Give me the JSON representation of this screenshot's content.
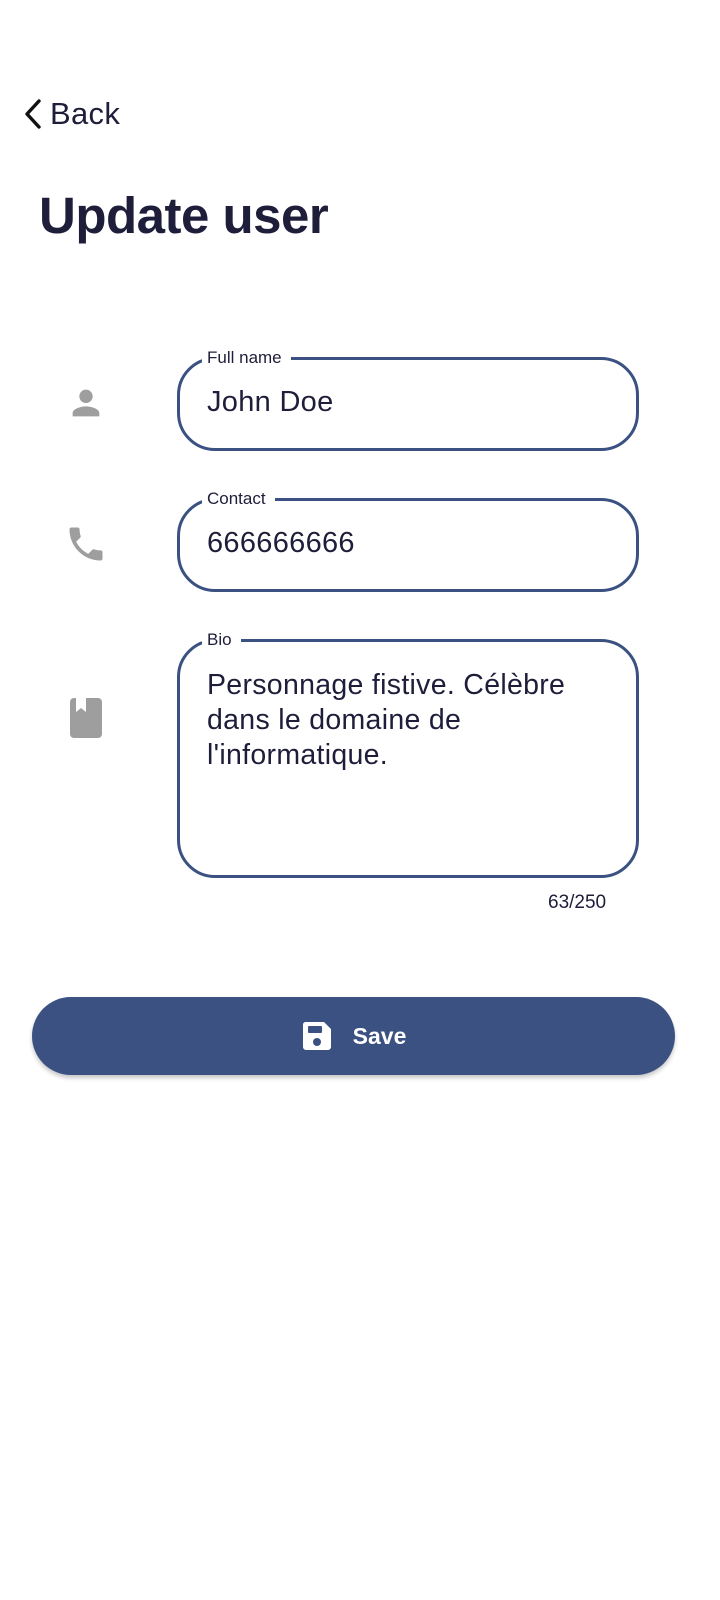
{
  "nav": {
    "back_label": "Back"
  },
  "page": {
    "title": "Update user"
  },
  "form": {
    "full_name": {
      "label": "Full name",
      "value": "John Doe",
      "icon": "person-icon"
    },
    "contact": {
      "label": "Contact",
      "value": "666666666",
      "icon": "phone-icon"
    },
    "bio": {
      "label": "Bio",
      "value": "Personnage fistive. Célèbre dans le domaine de l'informatique.",
      "icon": "book-icon",
      "counter": "63/250"
    }
  },
  "actions": {
    "save_label": "Save",
    "save_icon": "floppy-disk-icon"
  },
  "colors": {
    "accent": "#3a5181",
    "text": "#1e1d3a",
    "icon_grey": "#9e9e9e",
    "background": "#ffffff"
  }
}
